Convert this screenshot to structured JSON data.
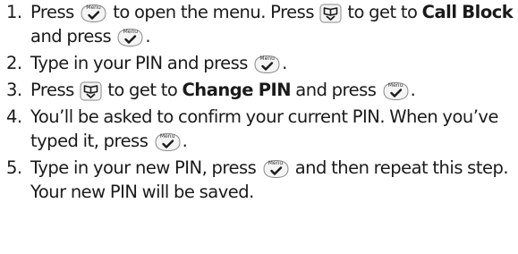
{
  "instructions": {
    "steps": [
      {
        "number": "1.",
        "parts": [
          {
            "type": "text",
            "value": "Press "
          },
          {
            "type": "key",
            "icon": "menu-ok-key-icon",
            "label": "Menu"
          },
          {
            "type": "text",
            "value": " to open the menu. Press "
          },
          {
            "type": "key",
            "icon": "phonebook-down-key-icon"
          },
          {
            "type": "text",
            "value": " to get to "
          },
          {
            "type": "bold",
            "value": "Call Block"
          },
          {
            "type": "text",
            "value": " and press "
          },
          {
            "type": "key",
            "icon": "menu-ok-key-icon",
            "label": "Menu"
          },
          {
            "type": "text",
            "value": "."
          }
        ]
      },
      {
        "number": "2.",
        "parts": [
          {
            "type": "text",
            "value": "Type in your PIN and press "
          },
          {
            "type": "key",
            "icon": "menu-ok-key-icon",
            "label": "Menu"
          },
          {
            "type": "text",
            "value": "."
          }
        ]
      },
      {
        "number": "3.",
        "parts": [
          {
            "type": "text",
            "value": "Press "
          },
          {
            "type": "key",
            "icon": "phonebook-down-key-icon"
          },
          {
            "type": "text",
            "value": " to get to "
          },
          {
            "type": "bold",
            "value": "Change PIN"
          },
          {
            "type": "text",
            "value": " and press "
          },
          {
            "type": "key",
            "icon": "menu-ok-key-icon",
            "label": "Menu"
          },
          {
            "type": "text",
            "value": "."
          }
        ]
      },
      {
        "number": "4.",
        "parts": [
          {
            "type": "text",
            "value": "You’ll be asked to confirm your current PIN. When you’ve typed it, press "
          },
          {
            "type": "key",
            "icon": "menu-ok-key-icon",
            "label": "Menu"
          },
          {
            "type": "text",
            "value": "."
          }
        ]
      },
      {
        "number": "5.",
        "parts": [
          {
            "type": "text",
            "value": "Type in your new PIN, press "
          },
          {
            "type": "key",
            "icon": "menu-ok-key-icon",
            "label": "Menu"
          },
          {
            "type": "text",
            "value": " and then repeat this step. Your new PIN will be saved."
          }
        ]
      }
    ]
  }
}
